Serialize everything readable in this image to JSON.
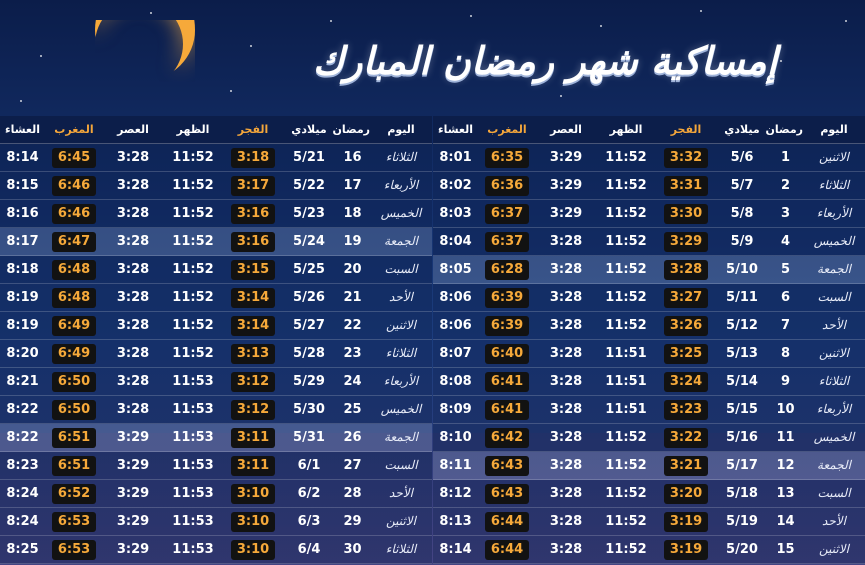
{
  "title": "إمساكية شهر رمضان المبارك",
  "colors": {
    "accent": "#f6a93a",
    "pill_bg": "#121212",
    "header_bg": "#0c1c46"
  },
  "headers": {
    "day": "اليوم",
    "ramadan": "رمضان",
    "gregorian": "ميلادي",
    "fajr": "الفجر",
    "dhuhr": "الظهر",
    "asr": "العصر",
    "maghrib": "المغرب",
    "isha": "العشاء"
  },
  "right_table": [
    {
      "day": "الاثنين",
      "ramadan": "1",
      "date": "5/6",
      "fajr": "3:32",
      "dhuhr": "11:52",
      "asr": "3:29",
      "maghrib": "6:35",
      "isha": "8:01"
    },
    {
      "day": "الثلاثاء",
      "ramadan": "2",
      "date": "5/7",
      "fajr": "3:31",
      "dhuhr": "11:52",
      "asr": "3:29",
      "maghrib": "6:36",
      "isha": "8:02"
    },
    {
      "day": "الأربعاء",
      "ramadan": "3",
      "date": "5/8",
      "fajr": "3:30",
      "dhuhr": "11:52",
      "asr": "3:29",
      "maghrib": "6:37",
      "isha": "8:03"
    },
    {
      "day": "الخميس",
      "ramadan": "4",
      "date": "5/9",
      "fajr": "3:29",
      "dhuhr": "11:52",
      "asr": "3:28",
      "maghrib": "6:37",
      "isha": "8:04"
    },
    {
      "day": "الجمعة",
      "ramadan": "5",
      "date": "5/10",
      "fajr": "3:28",
      "dhuhr": "11:52",
      "asr": "3:28",
      "maghrib": "6:28",
      "isha": "8:05"
    },
    {
      "day": "السبت",
      "ramadan": "6",
      "date": "5/11",
      "fajr": "3:27",
      "dhuhr": "11:52",
      "asr": "3:28",
      "maghrib": "6:39",
      "isha": "8:06"
    },
    {
      "day": "الأحد",
      "ramadan": "7",
      "date": "5/12",
      "fajr": "3:26",
      "dhuhr": "11:52",
      "asr": "3:28",
      "maghrib": "6:39",
      "isha": "8:06"
    },
    {
      "day": "الاثنين",
      "ramadan": "8",
      "date": "5/13",
      "fajr": "3:25",
      "dhuhr": "11:51",
      "asr": "3:28",
      "maghrib": "6:40",
      "isha": "8:07"
    },
    {
      "day": "الثلاثاء",
      "ramadan": "9",
      "date": "5/14",
      "fajr": "3:24",
      "dhuhr": "11:51",
      "asr": "3:28",
      "maghrib": "6:41",
      "isha": "8:08"
    },
    {
      "day": "الأربعاء",
      "ramadan": "10",
      "date": "5/15",
      "fajr": "3:23",
      "dhuhr": "11:51",
      "asr": "3:28",
      "maghrib": "6:41",
      "isha": "8:09"
    },
    {
      "day": "الخميس",
      "ramadan": "11",
      "date": "5/16",
      "fajr": "3:22",
      "dhuhr": "11:52",
      "asr": "3:28",
      "maghrib": "6:42",
      "isha": "8:10"
    },
    {
      "day": "الجمعة",
      "ramadan": "12",
      "date": "5/17",
      "fajr": "3:21",
      "dhuhr": "11:52",
      "asr": "3:28",
      "maghrib": "6:43",
      "isha": "8:11"
    },
    {
      "day": "السبت",
      "ramadan": "13",
      "date": "5/18",
      "fajr": "3:20",
      "dhuhr": "11:52",
      "asr": "3:28",
      "maghrib": "6:43",
      "isha": "8:12"
    },
    {
      "day": "الأحد",
      "ramadan": "14",
      "date": "5/19",
      "fajr": "3:19",
      "dhuhr": "11:52",
      "asr": "3:28",
      "maghrib": "6:44",
      "isha": "8:13"
    },
    {
      "day": "الاثنين",
      "ramadan": "15",
      "date": "5/20",
      "fajr": "3:19",
      "dhuhr": "11:52",
      "asr": "3:28",
      "maghrib": "6:44",
      "isha": "8:14"
    }
  ],
  "left_table": [
    {
      "day": "الثلاثاء",
      "ramadan": "16",
      "date": "5/21",
      "fajr": "3:18",
      "dhuhr": "11:52",
      "asr": "3:28",
      "maghrib": "6:45",
      "isha": "8:14"
    },
    {
      "day": "الأربعاء",
      "ramadan": "17",
      "date": "5/22",
      "fajr": "3:17",
      "dhuhr": "11:52",
      "asr": "3:28",
      "maghrib": "6:46",
      "isha": "8:15"
    },
    {
      "day": "الخميس",
      "ramadan": "18",
      "date": "5/23",
      "fajr": "3:16",
      "dhuhr": "11:52",
      "asr": "3:28",
      "maghrib": "6:46",
      "isha": "8:16"
    },
    {
      "day": "الجمعة",
      "ramadan": "19",
      "date": "5/24",
      "fajr": "3:16",
      "dhuhr": "11:52",
      "asr": "3:28",
      "maghrib": "6:47",
      "isha": "8:17"
    },
    {
      "day": "السبت",
      "ramadan": "20",
      "date": "5/25",
      "fajr": "3:15",
      "dhuhr": "11:52",
      "asr": "3:28",
      "maghrib": "6:48",
      "isha": "8:18"
    },
    {
      "day": "الأحد",
      "ramadan": "21",
      "date": "5/26",
      "fajr": "3:14",
      "dhuhr": "11:52",
      "asr": "3:28",
      "maghrib": "6:48",
      "isha": "8:19"
    },
    {
      "day": "الاثنين",
      "ramadan": "22",
      "date": "5/27",
      "fajr": "3:14",
      "dhuhr": "11:52",
      "asr": "3:28",
      "maghrib": "6:49",
      "isha": "8:19"
    },
    {
      "day": "الثلاثاء",
      "ramadan": "23",
      "date": "5/28",
      "fajr": "3:13",
      "dhuhr": "11:52",
      "asr": "3:28",
      "maghrib": "6:49",
      "isha": "8:20"
    },
    {
      "day": "الأربعاء",
      "ramadan": "24",
      "date": "5/29",
      "fajr": "3:12",
      "dhuhr": "11:53",
      "asr": "3:28",
      "maghrib": "6:50",
      "isha": "8:21"
    },
    {
      "day": "الخميس",
      "ramadan": "25",
      "date": "5/30",
      "fajr": "3:12",
      "dhuhr": "11:53",
      "asr": "3:28",
      "maghrib": "6:50",
      "isha": "8:22"
    },
    {
      "day": "الجمعة",
      "ramadan": "26",
      "date": "5/31",
      "fajr": "3:11",
      "dhuhr": "11:53",
      "asr": "3:29",
      "maghrib": "6:51",
      "isha": "8:22"
    },
    {
      "day": "السبت",
      "ramadan": "27",
      "date": "6/1",
      "fajr": "3:11",
      "dhuhr": "11:53",
      "asr": "3:29",
      "maghrib": "6:51",
      "isha": "8:23"
    },
    {
      "day": "الأحد",
      "ramadan": "28",
      "date": "6/2",
      "fajr": "3:10",
      "dhuhr": "11:53",
      "asr": "3:29",
      "maghrib": "6:52",
      "isha": "8:24"
    },
    {
      "day": "الاثنين",
      "ramadan": "29",
      "date": "6/3",
      "fajr": "3:10",
      "dhuhr": "11:53",
      "asr": "3:29",
      "maghrib": "6:53",
      "isha": "8:24"
    },
    {
      "day": "الثلاثاء",
      "ramadan": "30",
      "date": "6/4",
      "fajr": "3:10",
      "dhuhr": "11:53",
      "asr": "3:29",
      "maghrib": "6:53",
      "isha": "8:25"
    }
  ]
}
